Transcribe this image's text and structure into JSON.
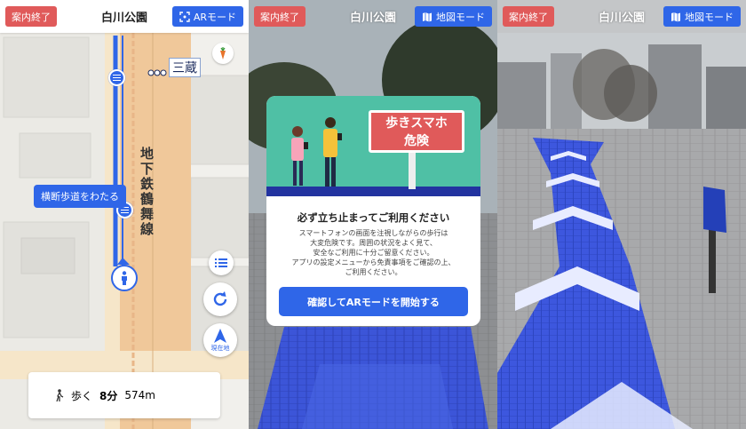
{
  "colors": {
    "accent": "#2f66e8",
    "end": "#e05a5a",
    "illust_bg": "#4fc0a5"
  },
  "panels": {
    "map": {
      "header": {
        "end_label": "案内終了",
        "title": "白川公園",
        "mode_label": "ARモード",
        "mode_icon": "ar-frame-icon"
      },
      "station_label": "三蔵",
      "line_label": "地下鉄鶴舞線",
      "route_tip": "横断歩道をわたる",
      "current_location_label": "現在地",
      "walk": {
        "mode_label": "歩く",
        "time": "8分",
        "distance": "574m"
      }
    },
    "warning": {
      "header": {
        "end_label": "案内終了",
        "title": "白川公園",
        "mode_label": "地図モード",
        "mode_icon": "map-icon"
      },
      "modal": {
        "sign_lines": [
          "歩きスマホ",
          "危険"
        ],
        "title": "必ず立ち止まってご利用ください",
        "body_lines": [
          "スマートフォンの画面を注視しながらの歩行は",
          "大変危険です。周囲の状況をよく見て、",
          "安全なご利用に十分ご留意ください。",
          "アプリの設定メニューから免責事項をご確認の上、",
          "ご利用ください。"
        ],
        "confirm_label": "確認してARモードを開始する"
      }
    },
    "ar": {
      "header": {
        "end_label": "案内終了",
        "title": "白川公園",
        "mode_label": "地図モード",
        "mode_icon": "map-icon"
      }
    }
  }
}
